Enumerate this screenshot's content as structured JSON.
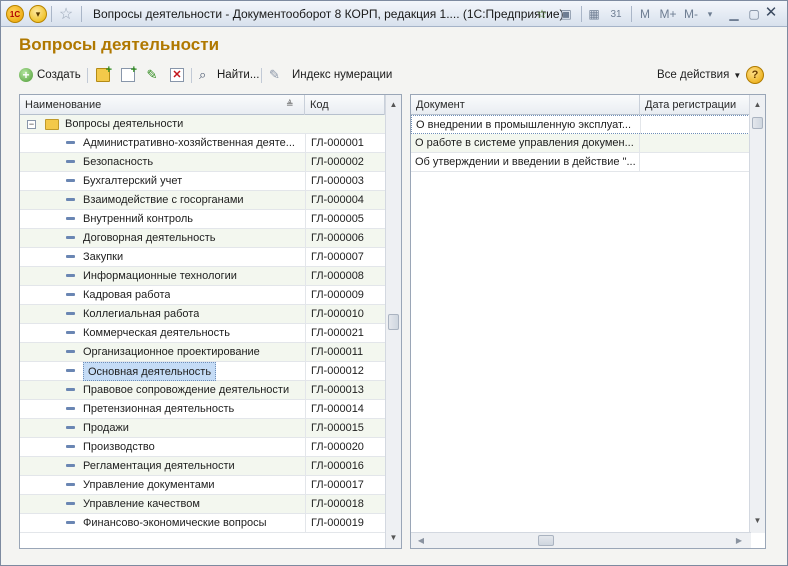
{
  "titlebar": {
    "title": "Вопросы деятельности - Документооборот 8 КОРП, редакция 1....  (1С:Предприятие)",
    "logo": "1С",
    "memory_buttons": [
      "M",
      "M+",
      "M-"
    ],
    "close_glyph": "✕"
  },
  "form": {
    "title": "Вопросы деятельности"
  },
  "toolbar": {
    "create_label": "Создать",
    "find_label": "Найти...",
    "index_label": "Индекс нумерации",
    "all_actions_label": "Все действия",
    "help_glyph": "?"
  },
  "left_table": {
    "columns": [
      "Наименование",
      "Код"
    ],
    "group": "Вопросы деятельности",
    "rows": [
      {
        "name": "Административно-хозяйственная деяте...",
        "code": "ГЛ-000001"
      },
      {
        "name": "Безопасность",
        "code": "ГЛ-000002"
      },
      {
        "name": "Бухгалтерский учет",
        "code": "ГЛ-000003"
      },
      {
        "name": "Взаимодействие с госорганами",
        "code": "ГЛ-000004"
      },
      {
        "name": "Внутренний контроль",
        "code": "ГЛ-000005"
      },
      {
        "name": "Договорная деятельность",
        "code": "ГЛ-000006"
      },
      {
        "name": "Закупки",
        "code": "ГЛ-000007"
      },
      {
        "name": "Информационные технологии",
        "code": "ГЛ-000008"
      },
      {
        "name": "Кадровая работа",
        "code": "ГЛ-000009"
      },
      {
        "name": "Коллегиальная работа",
        "code": "ГЛ-000010"
      },
      {
        "name": "Коммерческая деятельность",
        "code": "ГЛ-000021"
      },
      {
        "name": "Организационное проектирование",
        "code": "ГЛ-000011"
      },
      {
        "name": "Основная деятельность",
        "code": "ГЛ-000012",
        "selected": true
      },
      {
        "name": "Правовое сопровождение деятельности",
        "code": "ГЛ-000013"
      },
      {
        "name": "Претензионная деятельность",
        "code": "ГЛ-000014"
      },
      {
        "name": "Продажи",
        "code": "ГЛ-000015"
      },
      {
        "name": "Производство",
        "code": "ГЛ-000020"
      },
      {
        "name": "Регламентация деятельности",
        "code": "ГЛ-000016"
      },
      {
        "name": "Управление документами",
        "code": "ГЛ-000017"
      },
      {
        "name": "Управление качеством",
        "code": "ГЛ-000018"
      },
      {
        "name": "Финансово-экономические вопросы",
        "code": "ГЛ-000019"
      }
    ]
  },
  "right_table": {
    "columns": [
      "Документ",
      "Дата регистрации"
    ],
    "rows": [
      {
        "document": "О внедрении в промышленную эксплуат...",
        "date": ""
      },
      {
        "document": "О работе в системе управления докумен...",
        "date": ""
      },
      {
        "document": "Об утверждении и введении в действие \"...",
        "date": ""
      }
    ]
  },
  "colors": {
    "title_accent": "#b07800",
    "selection": "#c5dcf6",
    "alt_row": "#f3f7ef"
  }
}
